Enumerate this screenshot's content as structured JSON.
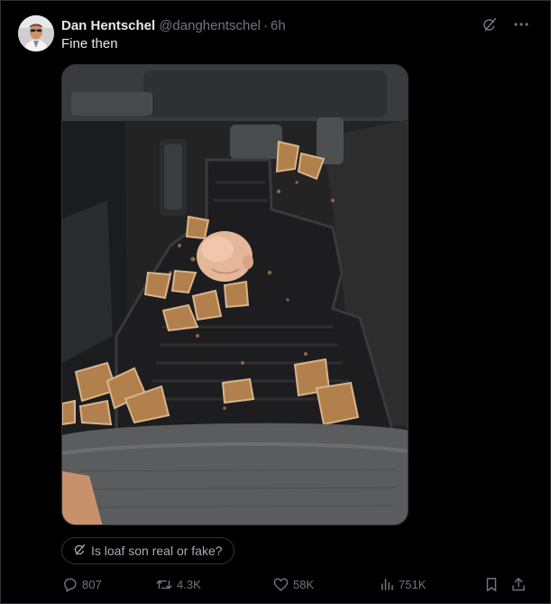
{
  "author": {
    "display_name": "Dan Hentschel",
    "handle": "@danghentschel",
    "separator": "·",
    "time": "6h"
  },
  "tweet": {
    "text": "Fine then"
  },
  "grok_prompt": {
    "label": "Is loaf son real or fake?",
    "icon": "grok-icon"
  },
  "stats": {
    "replies": "807",
    "reposts": "4.3K",
    "likes": "58K",
    "views": "751K"
  },
  "icons": {
    "top_right": [
      "grok-icon",
      "more-icon"
    ],
    "actions": [
      "reply-icon",
      "repost-icon",
      "like-icon",
      "views-icon",
      "bookmark-icon",
      "share-icon"
    ]
  },
  "colors": {
    "background": "#000000",
    "text_primary": "#e7e9ea",
    "text_secondary": "#71767b",
    "border": "#2f3336"
  }
}
